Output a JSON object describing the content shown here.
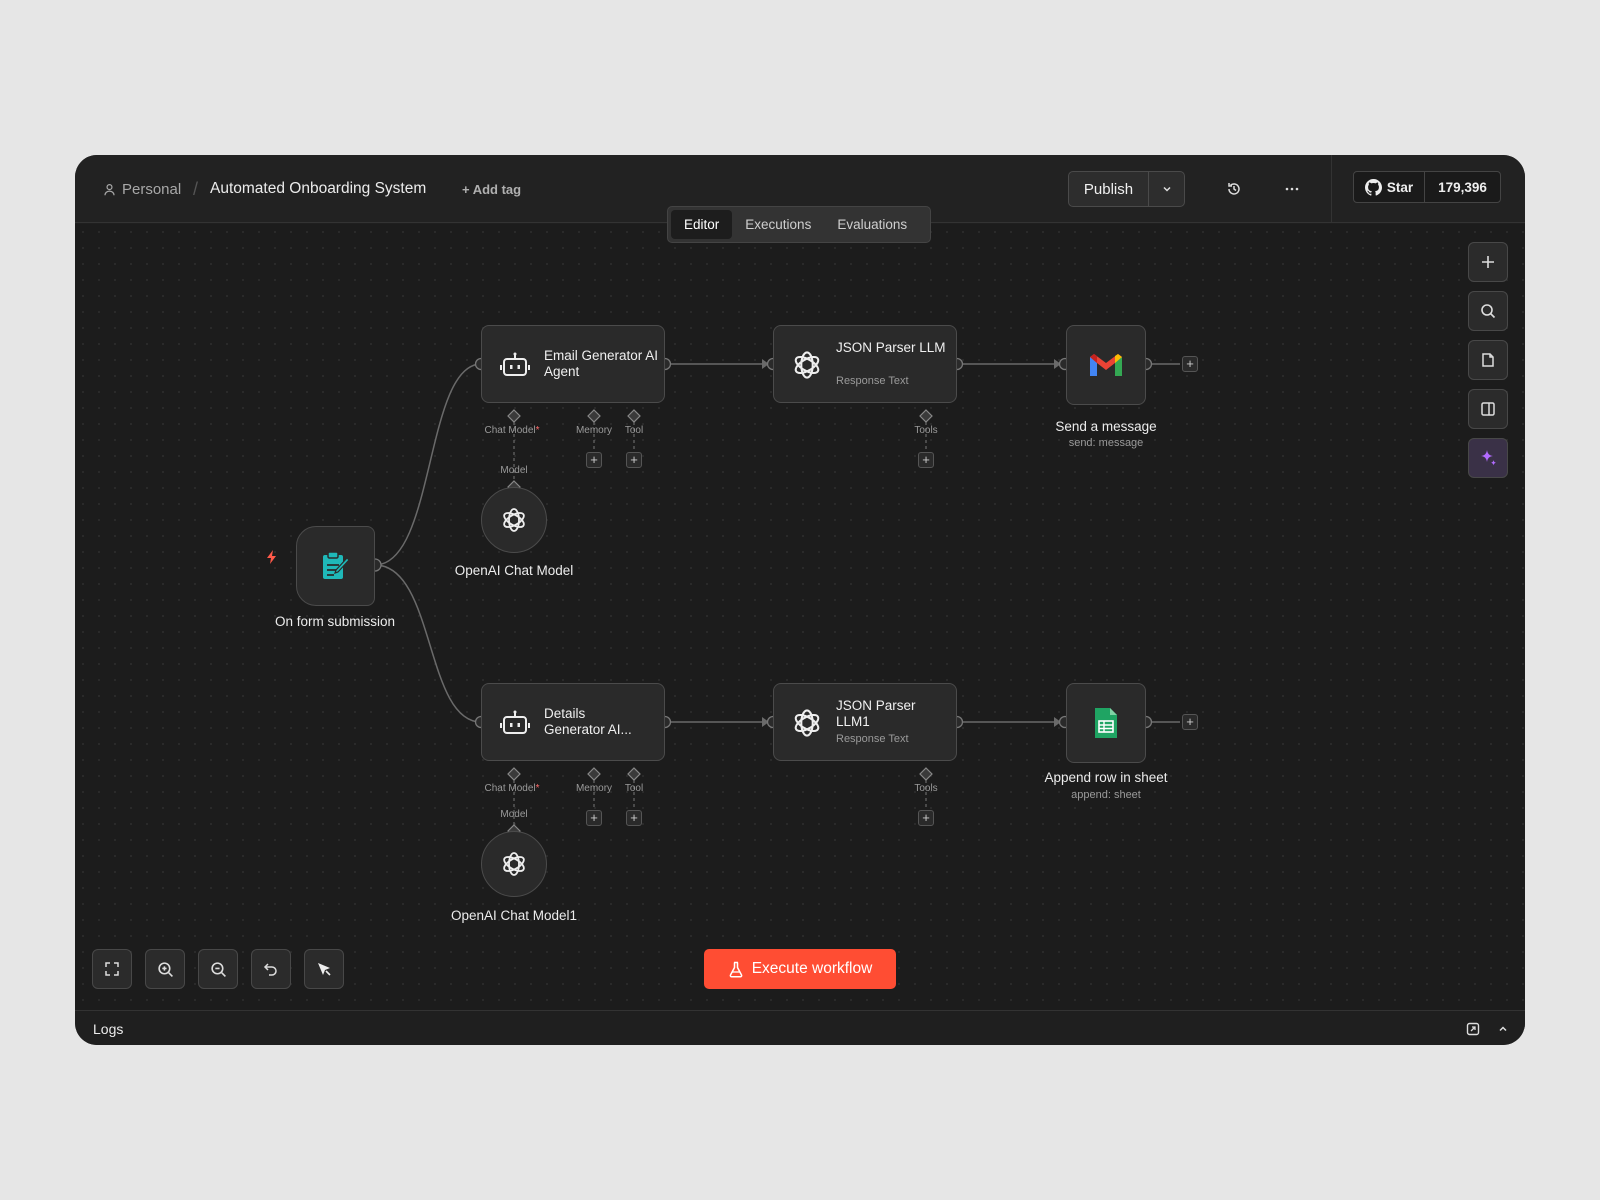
{
  "breadcrumb": {
    "workspace": "Personal",
    "separator": "/",
    "workflow_name": "Automated Onboarding System",
    "add_tag": "+ Add tag"
  },
  "header": {
    "publish_label": "Publish",
    "github_star_label": "Star",
    "github_star_count": "179,396"
  },
  "tabs": [
    {
      "label": "Editor",
      "active": true
    },
    {
      "label": "Executions",
      "active": false
    },
    {
      "label": "Evaluations",
      "active": false
    }
  ],
  "nodes": {
    "trigger": {
      "label": "On form submission"
    },
    "email_agent": {
      "title": "Email Generator AI Agent"
    },
    "json_parser_1": {
      "title": "JSON Parser LLM",
      "subtitle": "Response Text"
    },
    "gmail": {
      "label": "Send a message",
      "subtitle": "send: message"
    },
    "chat_model_1": {
      "label": "OpenAI Chat Model"
    },
    "details_agent": {
      "title": "Details Generator AI..."
    },
    "json_parser_2": {
      "title": "JSON Parser LLM1",
      "subtitle": "Response Text"
    },
    "sheets": {
      "label": "Append row in sheet",
      "subtitle": "append: sheet"
    },
    "chat_model_2": {
      "label": "OpenAI Chat Model1"
    }
  },
  "ports": {
    "chat_model": "Chat Model",
    "required_mark": "*",
    "memory": "Memory",
    "tool": "Tool",
    "tools": "Tools",
    "model": "Model"
  },
  "plus_glyph": "+",
  "execute_label": "Execute workflow",
  "logs_label": "Logs",
  "colors": {
    "accent": "#ff4d33",
    "form_icon": "#1fb8b8",
    "sheets_green": "#1fa463",
    "ai_purple": "#b26bff"
  },
  "icons": [
    "user-icon",
    "history-icon",
    "more-icon",
    "chevron-down-icon",
    "github-icon",
    "robot-icon",
    "openai-icon",
    "gmail-icon",
    "sheets-icon",
    "form-icon",
    "bolt-icon",
    "plus-icon",
    "search-icon",
    "sticky-note-icon",
    "panel-icon",
    "sparkle-icon",
    "fit-view-icon",
    "zoom-in-icon",
    "zoom-out-icon",
    "undo-icon",
    "tidy-up-icon",
    "flask-icon",
    "popout-icon",
    "chevron-up-icon"
  ]
}
